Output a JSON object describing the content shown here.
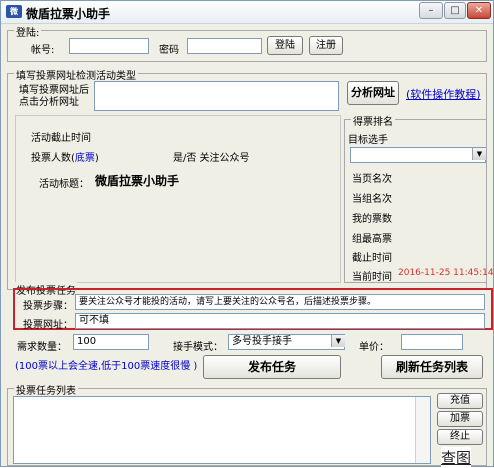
{
  "window": {
    "title": "微盾拉票小助手",
    "icon": "app-logo-icon",
    "minimize": "–",
    "maximize": "□",
    "close": "✕"
  },
  "login": {
    "group_label": "登陆:",
    "account_label": "帐号:",
    "account_value": "",
    "password_label": "密码",
    "password_value": "",
    "login_button": "登陆",
    "register_button": "注册"
  },
  "url_section": {
    "group_label": "填写投票网址检测活动类型",
    "hint": "填写投票网址后点击分析网址",
    "url_value": "",
    "analyze_button": "分析网址",
    "tutorial_link": "(软件操作教程)"
  },
  "activity": {
    "deadline_label": "活动截止时间",
    "voters_label": "投票人数(",
    "voters_link": "底票",
    "voters_close": ")",
    "follow_label": "是/否 关注公众号",
    "title_label": "活动标题：",
    "title_value": "微盾拉票小助手"
  },
  "ranking": {
    "group_label": "得票排名",
    "target_label": "目标选手",
    "target_value": "",
    "items": [
      "当页名次",
      "当组名次",
      "我的票数",
      "组最高票",
      "截止时间",
      "当前时间"
    ],
    "current_time": "2016-11-25 11:45:14"
  },
  "task": {
    "group_label": "发布投票任务",
    "steps_label": "投票步骤：",
    "steps_value": "要关注公众号才能投的活动，请写上要关注的公众号名，后描述投票步骤。",
    "url_label": "投票网址：",
    "url_value": "可不填",
    "quantity_label": "需求数量：",
    "quantity_value": "100",
    "mode_label": "接手模式：",
    "mode_value": "多号投手接手",
    "price_label": "单价：",
    "price_value": "",
    "speed_note": "(100票以上会全速,低于100票速度很慢 )",
    "publish_button": "发布任务",
    "refresh_button": "刷新任务列表"
  },
  "task_list": {
    "group_label": "投票任务列表",
    "buttons": [
      "充值",
      "加票",
      "终止"
    ],
    "watermark": "查图"
  },
  "colors": {
    "highlight_border": "#c8232c",
    "link": "#0000cc",
    "time_red": "#d4322c"
  }
}
